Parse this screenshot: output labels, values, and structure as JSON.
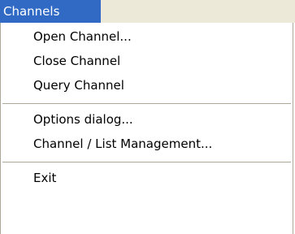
{
  "menubar": {
    "title": "Channels"
  },
  "menu": {
    "group1": [
      {
        "label": "Open Channel..."
      },
      {
        "label": "Close Channel"
      },
      {
        "label": "Query Channel"
      }
    ],
    "group2": [
      {
        "label": "Options dialog..."
      },
      {
        "label": "Channel / List Management..."
      }
    ],
    "group3": [
      {
        "label": "Exit"
      }
    ]
  },
  "colors": {
    "menubar_highlight": "#316ac5",
    "menubar_background": "#ece9d8",
    "menu_background": "#ffffff",
    "separator": "#aca899"
  }
}
